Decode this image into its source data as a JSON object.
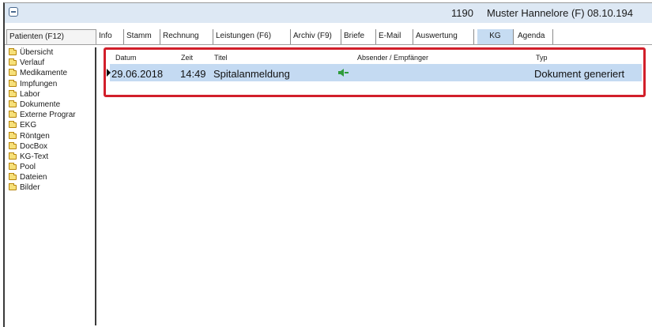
{
  "window": {
    "patient_id": "1190",
    "patient_name": "Muster Hannelore (F) 08.10.194"
  },
  "tabs": [
    {
      "label": "Patienten (F12)"
    },
    {
      "label": "Info"
    },
    {
      "label": "Stamm"
    },
    {
      "label": "Rechnung"
    },
    {
      "label": "Leistungen (F6)"
    },
    {
      "label": "Archiv (F9)"
    },
    {
      "label": "Briefe"
    },
    {
      "label": "E-Mail"
    },
    {
      "label": "Auswertung"
    },
    {
      "label": "KG"
    },
    {
      "label": "Agenda"
    }
  ],
  "sidebar": {
    "items": [
      {
        "label": "Übersicht"
      },
      {
        "label": "Verlauf"
      },
      {
        "label": "Medikamente"
      },
      {
        "label": "Impfungen"
      },
      {
        "label": "Labor"
      },
      {
        "label": "Dokumente"
      },
      {
        "label": "Externe Prograr"
      },
      {
        "label": "EKG"
      },
      {
        "label": "Röntgen"
      },
      {
        "label": "DocBox"
      },
      {
        "label": "KG-Text"
      },
      {
        "label": "Pool"
      },
      {
        "label": "Dateien"
      },
      {
        "label": "Bilder"
      }
    ]
  },
  "table": {
    "columns": {
      "datum": "Datum",
      "zeit": "Zeit",
      "titel": "Titel",
      "absender": "Absender / Empfänger",
      "typ": "Typ"
    },
    "rows": [
      {
        "datum": "29.06.2018",
        "zeit": "14:49",
        "titel": "Spitalanmeldung",
        "absender_icon": "speaker-icon",
        "typ": "Dokument generiert"
      }
    ]
  },
  "colors": {
    "highlight_border": "#d21f2a",
    "selected_row": "#c4daf2",
    "active_tab": "#c6dcf2",
    "titlebar": "#dde8f4"
  }
}
